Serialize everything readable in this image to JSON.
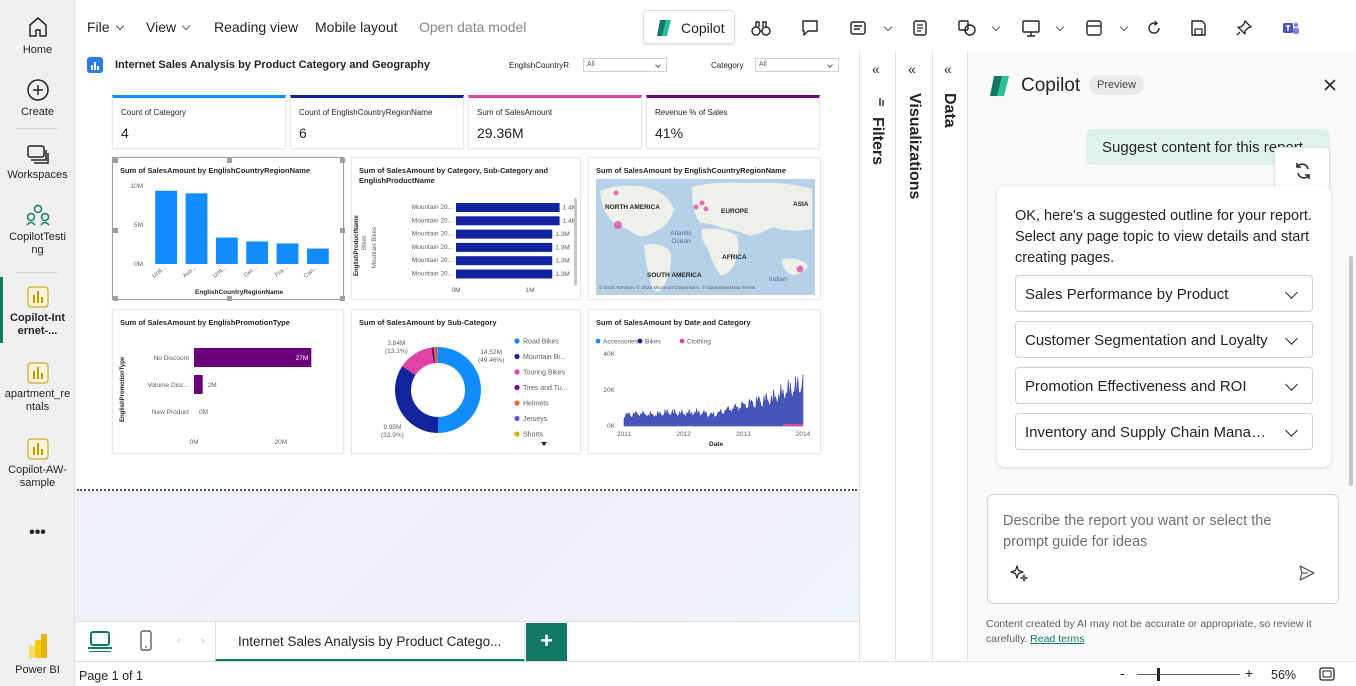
{
  "nav": {
    "items": [
      {
        "label": "Home"
      },
      {
        "label": "Create"
      },
      {
        "label": "Workspaces"
      },
      {
        "label": "CopilotTesting"
      },
      {
        "label": "Copilot-Internet-..."
      },
      {
        "label": "apartment_rentals"
      },
      {
        "label": "Copilot-AW-sample"
      }
    ],
    "more": "•••",
    "brand": "Power BI"
  },
  "toolbar": {
    "file": "File",
    "view": "View",
    "reading_view": "Reading view",
    "mobile_layout": "Mobile layout",
    "open_data_model": "Open data model",
    "copilot": "Copilot"
  },
  "report": {
    "title": "Internet Sales Analysis by Product Category and Geography",
    "slicers": [
      {
        "label": "EnglishCountryR",
        "value": "All"
      },
      {
        "label": "Category",
        "value": "All"
      }
    ],
    "kpis": [
      {
        "label": "Count of Category",
        "value": "4",
        "color": "#118dff"
      },
      {
        "label": "Count of EnglishCountryRegionName",
        "value": "6",
        "color": "#12239e"
      },
      {
        "label": "Sum of SalesAmount",
        "value": "29.36M",
        "color": "#e66c37"
      },
      {
        "label": "Revenue % of Sales",
        "value": "41%",
        "color": "#6b007b"
      }
    ]
  },
  "chart_data": [
    {
      "type": "bar",
      "title": "Sum of SalesAmount by EnglishCountryRegionName",
      "xlabel": "EnglishCountryRegionName",
      "categories": [
        "Unit...",
        "Aus...",
        "Unit...",
        "Ger...",
        "Fra...",
        "Can..."
      ],
      "values": [
        9.39,
        9.06,
        3.39,
        2.89,
        2.64,
        1.98
      ],
      "ytick_labels": [
        "10M",
        "5M",
        "0M"
      ],
      "ylim": [
        0,
        10
      ],
      "color": "#118dff"
    },
    {
      "type": "bar",
      "orientation": "horizontal",
      "title": "Sum of SalesAmount by Category, Sub-Category and EnglishProductName",
      "ylabel": "EnglishProductName",
      "group_labels": [
        "Bikes",
        "Mountain Bikes"
      ],
      "categories": [
        "Mountain 20...",
        "Mountain 20...",
        "Mountain 20...",
        "Mountain 20...",
        "Mountain 20...",
        "Mountain 20..."
      ],
      "value_labels": [
        "1.4M",
        "1.4M",
        "1.3M",
        "1.3M",
        "1.3M",
        "1.3M"
      ],
      "values": [
        1.4,
        1.4,
        1.3,
        1.3,
        1.3,
        1.3
      ],
      "xtick_labels": [
        "0M",
        "1M"
      ],
      "xlim": [
        0,
        1.5
      ],
      "color": "#12239e"
    },
    {
      "type": "map",
      "title": "Sum of SalesAmount by EnglishCountryRegionName",
      "labels": [
        "NORTH AMERICA",
        "EUROPE",
        "ASIA",
        "Atlantic Ocean",
        "AFRICA",
        "SOUTH AMERICA",
        "Indian"
      ],
      "attribution": "© 2025 TomTom, © 2025 Microsoft Corporation, © OpenStreetMap Terms"
    },
    {
      "type": "bar",
      "orientation": "horizontal",
      "title": "Sum of SalesAmount by EnglishPromotionType",
      "ylabel": "EnglishPromotionType",
      "categories": [
        "No Discount",
        "Volume Disc...",
        "New Product"
      ],
      "values": [
        27,
        2,
        0
      ],
      "value_labels": [
        "27M",
        "2M",
        "0M"
      ],
      "xtick_labels": [
        "0M",
        "20M"
      ],
      "xlim": [
        0,
        29
      ],
      "color": "#6b007b"
    },
    {
      "type": "pie",
      "donut": true,
      "title": "Sum of SalesAmount by Sub-Category",
      "categories": [
        "Road Bikes",
        "Mountain Bi...",
        "Touring Bikes",
        "Tires and Tu...",
        "Helmets",
        "Jerseys",
        "Shorts"
      ],
      "values": [
        14.52,
        9.95,
        3.84,
        0.25,
        0.23,
        0.17,
        0.07
      ],
      "colors": [
        "#118dff",
        "#12239e",
        "#e044a7",
        "#6b007b",
        "#e66c37",
        "#744ec2",
        "#d9b300"
      ],
      "data_labels": [
        {
          "value": "14.52M",
          "pct": "(49.46%)"
        },
        {
          "value": "9.95M",
          "pct": "(33.9%)"
        },
        {
          "value": "3.84M",
          "pct": "(13.1%)"
        }
      ]
    },
    {
      "type": "area",
      "title": "Sum of SalesAmount by Date and Category",
      "xlabel": "Date",
      "legend": [
        "Accessories",
        "Bikes",
        "Clothing"
      ],
      "legend_colors": [
        "#118dff",
        "#12239e",
        "#e044a7"
      ],
      "ytick_labels": [
        "40K",
        "20K",
        "0K"
      ],
      "xtick_labels": [
        "2011",
        "2012",
        "2013",
        "2014"
      ],
      "ylim": [
        0,
        40
      ],
      "x": [
        2011,
        2011.25,
        2011.5,
        2011.75,
        2012,
        2012.25,
        2012.5,
        2012.75,
        2013,
        2013.25,
        2013.5,
        2013.75,
        2014
      ],
      "series": [
        {
          "name": "Bikes",
          "values": [
            8,
            9,
            8,
            10,
            9,
            10,
            8,
            12,
            15,
            18,
            20,
            26,
            31
          ]
        }
      ]
    }
  ],
  "page_tab": {
    "label": "Internet Sales Analysis by Product Catego...",
    "add": "+"
  },
  "status": {
    "page": "Page 1 of 1",
    "zoom": "56%",
    "zoom_minus": "-",
    "zoom_plus": "+"
  },
  "panes": {
    "filters": "Filters",
    "visualizations": "Visualizations",
    "data": "Data"
  },
  "copilot": {
    "title": "Copilot",
    "badge": "Preview",
    "user_message": "Suggest content for this report",
    "response": "OK, here's a suggested outline for your report. Select any page topic to view details and start creating pages.",
    "topics": [
      "Sales Performance by Product",
      "Customer Segmentation and Loyalty",
      "Promotion Effectiveness and ROI",
      "Inventory and Supply Chain Management"
    ],
    "input_placeholder": "Describe the report you want or select the prompt guide for ideas",
    "disclaimer": "Content created by AI may not be accurate or appropriate, so review it carefully.",
    "read_terms": "Read terms"
  }
}
